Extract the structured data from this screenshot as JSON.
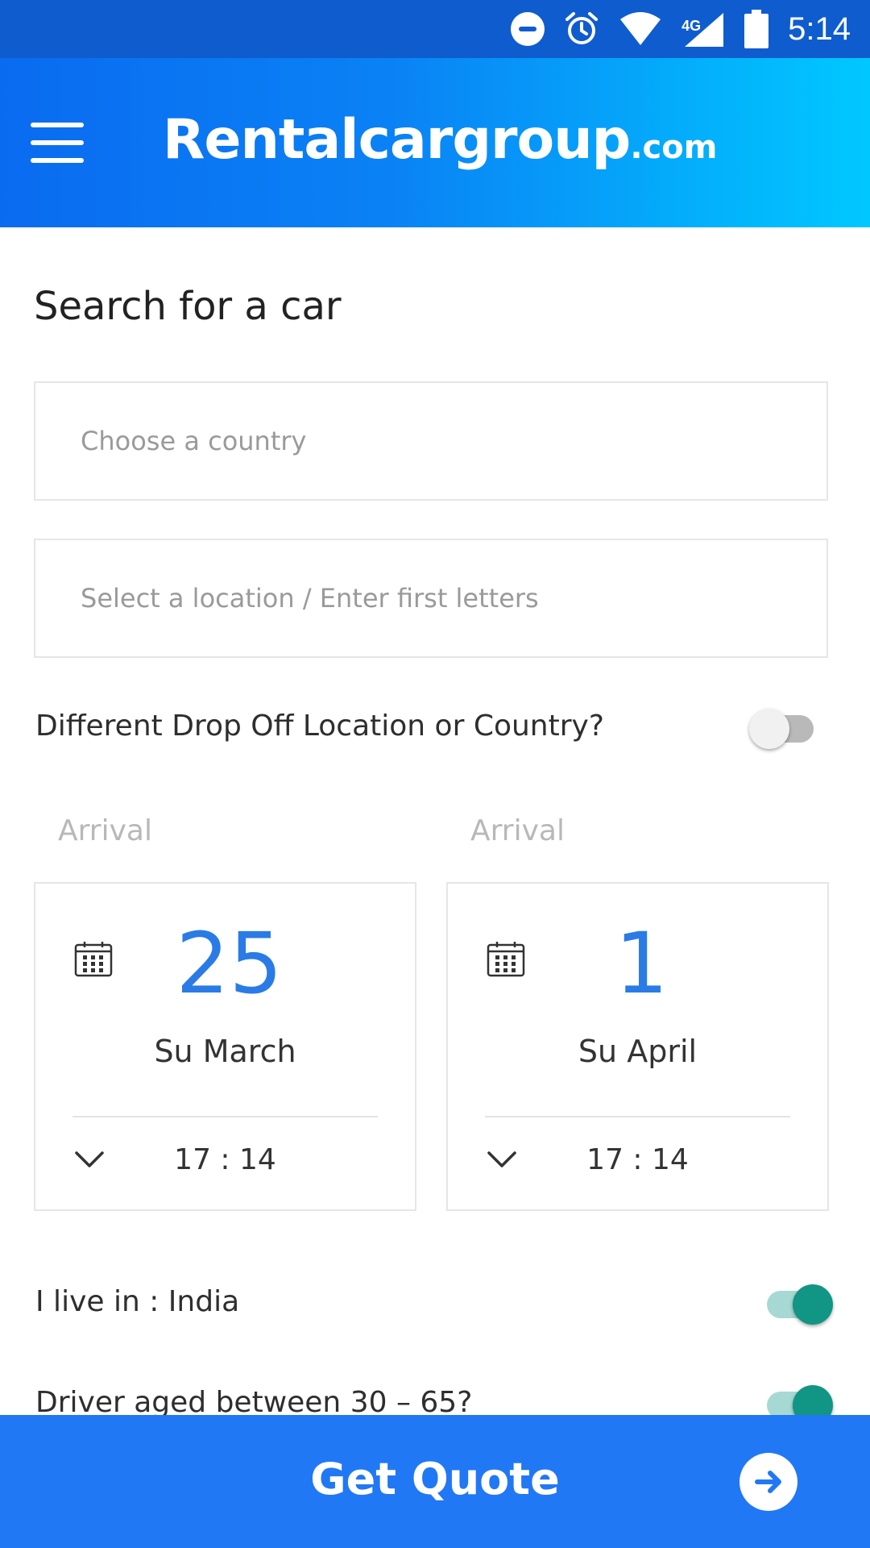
{
  "status_bar": {
    "time": "5:14",
    "network": "4G",
    "icons": [
      "do-not-disturb-icon",
      "alarm-icon",
      "wifi-icon",
      "signal-icon",
      "battery-icon"
    ]
  },
  "header": {
    "brand_main": "Rentalcargroup",
    "brand_tld": ".com",
    "menu_icon": "hamburger-menu-icon",
    "gradient_start": "#0a6bf0",
    "gradient_end": "#00c8ff"
  },
  "search": {
    "title": "Search for a car",
    "country_placeholder": "Choose a country",
    "country_value": "",
    "location_placeholder": "Select a location / Enter first letters",
    "location_value": ""
  },
  "dropoff": {
    "label": "Different Drop Off Location or Country?",
    "enabled": false
  },
  "pickup": {
    "label": "Arrival",
    "day": "25",
    "month": "Su March",
    "time": "17 : 14"
  },
  "return": {
    "label": "Arrival",
    "day": "1",
    "month": "Su April",
    "time": "17 : 14"
  },
  "residence": {
    "label": "I live in : India",
    "enabled": true
  },
  "driver_age": {
    "label": "Driver aged between 30 – 65?",
    "enabled": true
  },
  "cta": {
    "label": "Get Quote",
    "icon": "arrow-right-icon",
    "color": "#2178f5"
  },
  "colors": {
    "accent": "#2a7be6",
    "toggle_on": "#119584"
  }
}
